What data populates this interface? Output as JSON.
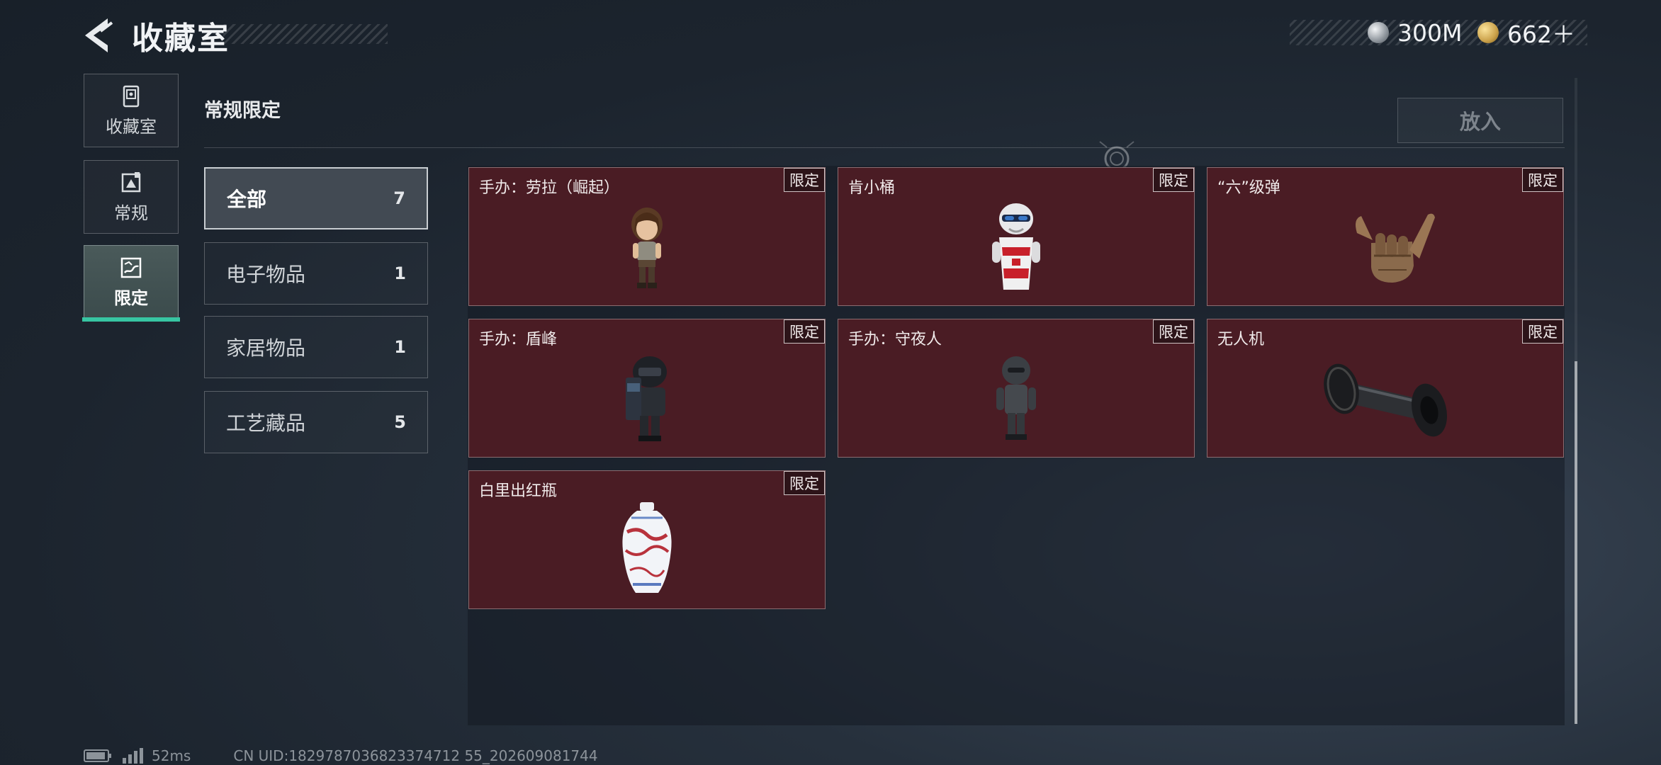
{
  "header": {
    "title": "收藏室",
    "currencies": [
      {
        "icon": "silver-coin-icon",
        "value": "300M"
      },
      {
        "icon": "gold-coin-icon",
        "value": "662＋"
      }
    ]
  },
  "sidebar": {
    "tabs": [
      {
        "label": "收藏室",
        "icon": "collection-room-icon",
        "active": false
      },
      {
        "label": "常规",
        "icon": "regular-icon",
        "active": false
      },
      {
        "label": "限定",
        "icon": "limited-icon",
        "active": true
      }
    ]
  },
  "section": {
    "title": "常规限定",
    "put_in_label": "放入"
  },
  "categories": [
    {
      "label": "全部",
      "count": "7",
      "selected": true
    },
    {
      "label": "电子物品",
      "count": "1",
      "selected": false
    },
    {
      "label": "家居物品",
      "count": "1",
      "selected": false
    },
    {
      "label": "工艺藏品",
      "count": "5",
      "selected": false
    }
  ],
  "items": [
    {
      "name": "手办：劳拉（崛起）",
      "badge": "限定",
      "art": "lara-figure-icon"
    },
    {
      "name": "肯小桶",
      "badge": "限定",
      "art": "bucket-mascot-icon"
    },
    {
      "name": "“六”级弹",
      "badge": "限定",
      "art": "hand-gesture-icon"
    },
    {
      "name": "手办：盾峰",
      "badge": "限定",
      "art": "shield-soldier-figure-icon"
    },
    {
      "name": "手办：守夜人",
      "badge": "限定",
      "art": "nightwatch-figure-icon"
    },
    {
      "name": "无人机",
      "badge": "限定",
      "art": "drone-roller-icon"
    },
    {
      "name": "白里出红瓶",
      "badge": "限定",
      "art": "porcelain-vase-icon"
    }
  ],
  "colors": {
    "accent": "#37c5a2",
    "card_bg": "#4a1c24"
  },
  "footer": {
    "ping": "52ms",
    "uid": "CN UID:1829787036823374712 55_202609081744"
  }
}
